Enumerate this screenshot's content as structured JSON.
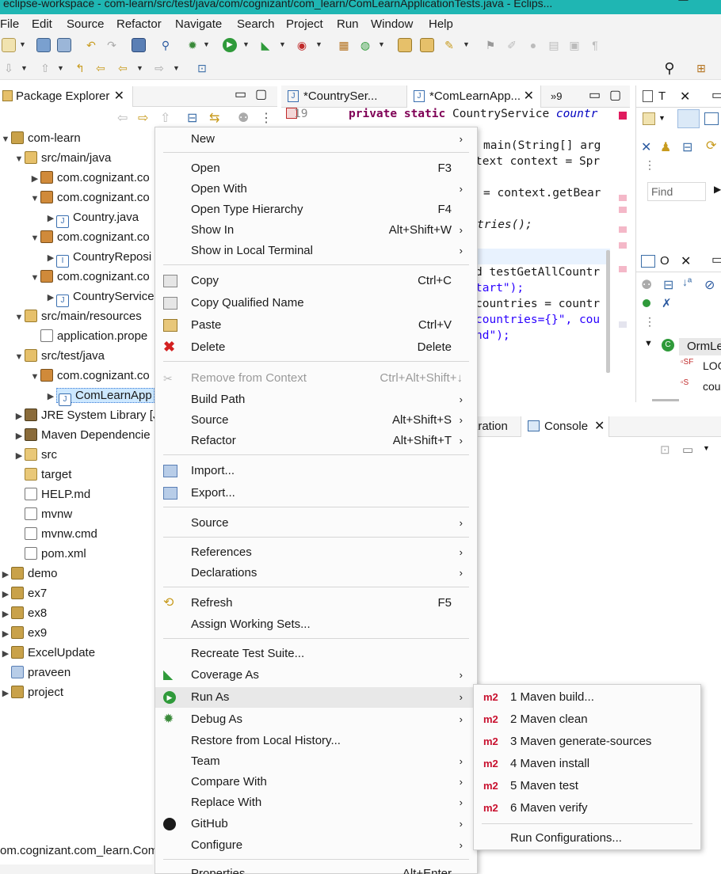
{
  "window": {
    "title": "eclipse-workspace - com-learn/src/test/java/com/cognizant/com_learn/ComLearnApplicationTests.java - Eclips..."
  },
  "menubar": [
    "File",
    "Edit",
    "Source",
    "Refactor",
    "Navigate",
    "Search",
    "Project",
    "Run",
    "Window",
    "Help"
  ],
  "package_explorer": {
    "tab_label": "Package Explorer",
    "tree": [
      {
        "label": "com-learn"
      },
      {
        "label": "src/main/java"
      },
      {
        "label": "com.cognizant.co"
      },
      {
        "label": "com.cognizant.co"
      },
      {
        "label": "Country.java"
      },
      {
        "label": "com.cognizant.co"
      },
      {
        "label": "CountryReposi"
      },
      {
        "label": "com.cognizant.co"
      },
      {
        "label": "CountryService"
      },
      {
        "label": "src/main/resources"
      },
      {
        "label": "application.prope"
      },
      {
        "label": "src/test/java"
      },
      {
        "label": "com.cognizant.co"
      },
      {
        "label": "ComLearnApp"
      },
      {
        "label": "JRE System Library [J"
      },
      {
        "label": "Maven Dependencie"
      },
      {
        "label": "src"
      },
      {
        "label": "target"
      },
      {
        "label": "HELP.md"
      },
      {
        "label": "mvnw"
      },
      {
        "label": "mvnw.cmd"
      },
      {
        "label": "pom.xml"
      },
      {
        "label": "demo"
      },
      {
        "label": "ex7"
      },
      {
        "label": "ex8"
      },
      {
        "label": "ex9"
      },
      {
        "label": "ExcelUpdate"
      },
      {
        "label": "praveen"
      },
      {
        "label": "project"
      }
    ],
    "status": "om.cognizant.com_learn.Com"
  },
  "editor": {
    "tabs": [
      "*CountrySer...",
      "*ComLearnApp...",
      "»9"
    ],
    "line_number": "19",
    "code": [
      "private static CountryService countr",
      "main(String[] arg",
      "text context = Spr",
      "= context.getBear",
      "tries();",
      "d testGetAllCountr",
      "tart\");",
      "countries = countr",
      "countries={}\", cou",
      "nd\");"
    ]
  },
  "outline": {
    "top_tab": "T",
    "find_placeholder": "Find",
    "bottom_tab": "O",
    "items": [
      "OrmLe",
      "LOG",
      "cou"
    ]
  },
  "console": {
    "prev_tab": "aration",
    "tab": "Console"
  },
  "context_menu": {
    "items": [
      {
        "label": "New",
        "accel": "",
        "sub": true
      },
      {
        "label": "Open",
        "accel": "F3",
        "sub": false
      },
      {
        "label": "Open With",
        "accel": "",
        "sub": true
      },
      {
        "label": "Open Type Hierarchy",
        "accel": "F4",
        "sub": false
      },
      {
        "label": "Show In",
        "accel": "Alt+Shift+W",
        "sub": true
      },
      {
        "label": "Show in Local Terminal",
        "accel": "",
        "sub": true
      },
      {
        "label": "Copy",
        "accel": "Ctrl+C",
        "sub": false
      },
      {
        "label": "Copy Qualified Name",
        "accel": "",
        "sub": false
      },
      {
        "label": "Paste",
        "accel": "Ctrl+V",
        "sub": false
      },
      {
        "label": "Delete",
        "accel": "Delete",
        "sub": false
      },
      {
        "label": "Remove from Context",
        "accel": "Ctrl+Alt+Shift+↓",
        "sub": false
      },
      {
        "label": "Build Path",
        "accel": "",
        "sub": true
      },
      {
        "label": "Source",
        "accel": "Alt+Shift+S",
        "sub": true
      },
      {
        "label": "Refactor",
        "accel": "Alt+Shift+T",
        "sub": true
      },
      {
        "label": "Import...",
        "accel": "",
        "sub": false
      },
      {
        "label": "Export...",
        "accel": "",
        "sub": false
      },
      {
        "label": "Source",
        "accel": "",
        "sub": true
      },
      {
        "label": "References",
        "accel": "",
        "sub": true
      },
      {
        "label": "Declarations",
        "accel": "",
        "sub": true
      },
      {
        "label": "Refresh",
        "accel": "F5",
        "sub": false
      },
      {
        "label": "Assign Working Sets...",
        "accel": "",
        "sub": false
      },
      {
        "label": "Recreate Test Suite...",
        "accel": "",
        "sub": false
      },
      {
        "label": "Coverage As",
        "accel": "",
        "sub": true
      },
      {
        "label": "Run As",
        "accel": "",
        "sub": true
      },
      {
        "label": "Debug As",
        "accel": "",
        "sub": true
      },
      {
        "label": "Restore from Local History...",
        "accel": "",
        "sub": false
      },
      {
        "label": "Team",
        "accel": "",
        "sub": true
      },
      {
        "label": "Compare With",
        "accel": "",
        "sub": true
      },
      {
        "label": "Replace With",
        "accel": "",
        "sub": true
      },
      {
        "label": "GitHub",
        "accel": "",
        "sub": true
      },
      {
        "label": "Configure",
        "accel": "",
        "sub": true
      },
      {
        "label": "Properties",
        "accel": "Alt+Enter",
        "sub": false
      }
    ]
  },
  "run_as_submenu": {
    "icon_text": "m2",
    "items": [
      "1 Maven build...",
      "2 Maven clean",
      "3 Maven generate-sources",
      "4 Maven install",
      "5 Maven test",
      "6 Maven verify"
    ],
    "footer": "Run Configurations..."
  }
}
